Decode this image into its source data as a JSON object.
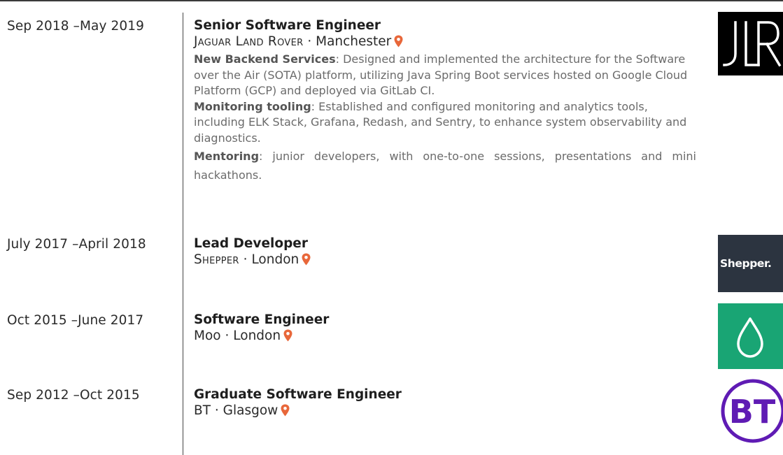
{
  "entries": [
    {
      "dates": "Sep 2018 –May 2019",
      "title": "Senior Software Engineer",
      "company": "Jaguar Land Rover",
      "location": "Manchester",
      "logo": "jlr-logo",
      "description": [
        {
          "label": "New Backend Services",
          "text": ": Designed and implemented the architecture for the Software over the Air (SOTA) platform, utilizing Java Spring Boot services hosted on Google Cloud Platform (GCP) and deployed via GitLab CI."
        },
        {
          "label": "Monitoring tooling",
          "text": ": Established and configured monitoring and analytics tools, including ELK Stack, Grafana, Redash, and Sentry, to enhance system observability and diagnostics."
        },
        {
          "label": "Mentoring",
          "text": ": junior developers, with one-to-one sessions, presentations and mini hackathons."
        }
      ]
    },
    {
      "dates": "July 2017 –April 2018",
      "title": "Lead Developer",
      "company": "Shepper",
      "location": "London",
      "logo": "shepper-logo",
      "logo_text": "Shepper."
    },
    {
      "dates": "Oct 2015 –June 2017",
      "title": "Software Engineer",
      "company": "Moo",
      "location": "London",
      "logo": "moo-logo"
    },
    {
      "dates": "Sep 2012 –Oct 2015",
      "title": "Graduate Software Engineer",
      "company": "BT",
      "location": "Glasgow",
      "logo": "bt-logo"
    }
  ],
  "separator": "·",
  "icons": {
    "location": "map-pin-icon"
  },
  "colors": {
    "pin": "#e8673a",
    "moo_green": "#19a574",
    "bt_purple": "#5f1bb4",
    "shepper_bg": "#2c3440"
  }
}
